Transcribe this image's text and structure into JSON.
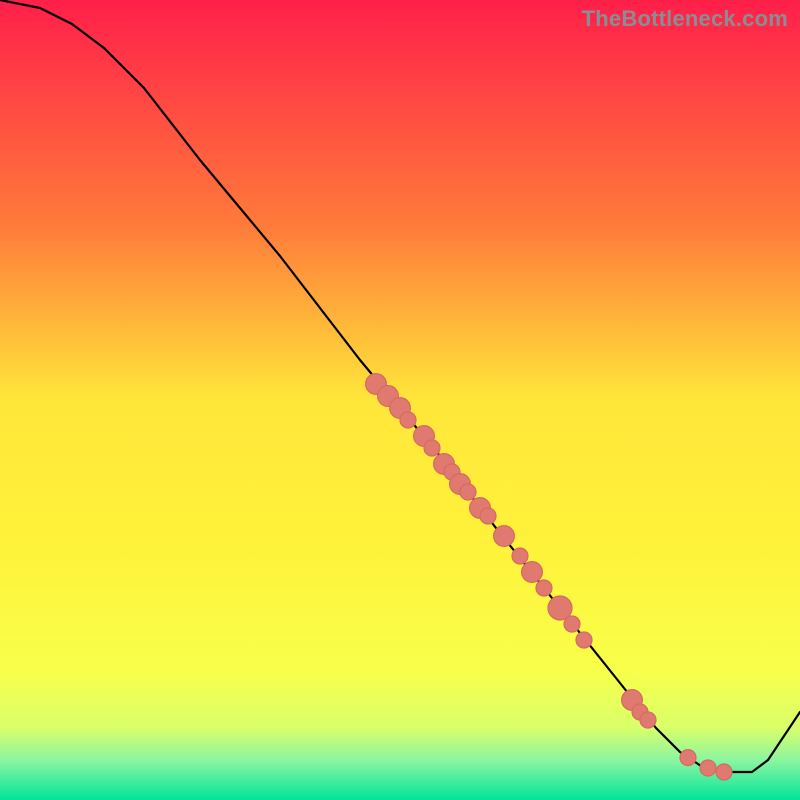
{
  "attribution": "TheBottleneck.com",
  "chart_data": {
    "type": "line",
    "title": "",
    "xlabel": "",
    "ylabel": "",
    "xlim": [
      0,
      100
    ],
    "ylim": [
      0,
      100
    ],
    "grid": false,
    "legend": false,
    "background_gradient": {
      "top": "#ff1f4a",
      "middle_upper": "#ffa33a",
      "middle": "#ffe63a",
      "lower_mid": "#f7ff3a",
      "near_bottom_1": "#bcff6a",
      "near_bottom_2": "#6af0b8",
      "bottom": "#00e59a"
    },
    "line_color": "#000000",
    "line": [
      {
        "x": 0,
        "y": 100
      },
      {
        "x": 5,
        "y": 99
      },
      {
        "x": 9,
        "y": 97
      },
      {
        "x": 13,
        "y": 94
      },
      {
        "x": 18,
        "y": 89
      },
      {
        "x": 25,
        "y": 80
      },
      {
        "x": 35,
        "y": 68
      },
      {
        "x": 45,
        "y": 55
      },
      {
        "x": 55,
        "y": 43
      },
      {
        "x": 62,
        "y": 34
      },
      {
        "x": 70,
        "y": 24
      },
      {
        "x": 78,
        "y": 14
      },
      {
        "x": 82,
        "y": 9
      },
      {
        "x": 85,
        "y": 6
      },
      {
        "x": 88,
        "y": 4
      },
      {
        "x": 90,
        "y": 3.5
      },
      {
        "x": 92,
        "y": 3.5
      },
      {
        "x": 94,
        "y": 3.5
      },
      {
        "x": 96,
        "y": 5
      },
      {
        "x": 98,
        "y": 8
      },
      {
        "x": 100,
        "y": 11
      }
    ],
    "markers": [
      {
        "x": 47,
        "y": 52,
        "r": 1.3
      },
      {
        "x": 48.5,
        "y": 50.5,
        "r": 1.3
      },
      {
        "x": 50,
        "y": 49,
        "r": 1.3
      },
      {
        "x": 51,
        "y": 47.5,
        "r": 1.0
      },
      {
        "x": 53,
        "y": 45.5,
        "r": 1.3
      },
      {
        "x": 54,
        "y": 44,
        "r": 1.0
      },
      {
        "x": 55.5,
        "y": 42,
        "r": 1.3
      },
      {
        "x": 56.5,
        "y": 41,
        "r": 1.0
      },
      {
        "x": 57.5,
        "y": 39.5,
        "r": 1.3
      },
      {
        "x": 58.5,
        "y": 38.5,
        "r": 1.0
      },
      {
        "x": 60,
        "y": 36.5,
        "r": 1.3
      },
      {
        "x": 61,
        "y": 35.5,
        "r": 1.0
      },
      {
        "x": 63,
        "y": 33,
        "r": 1.3
      },
      {
        "x": 65,
        "y": 30.5,
        "r": 1.0
      },
      {
        "x": 66.5,
        "y": 28.5,
        "r": 1.3
      },
      {
        "x": 68,
        "y": 26.5,
        "r": 1.0
      },
      {
        "x": 70,
        "y": 24,
        "r": 1.5
      },
      {
        "x": 71.5,
        "y": 22,
        "r": 1.0
      },
      {
        "x": 73,
        "y": 20,
        "r": 1.0
      },
      {
        "x": 79,
        "y": 12.5,
        "r": 1.3
      },
      {
        "x": 80,
        "y": 11,
        "r": 1.0
      },
      {
        "x": 81,
        "y": 10,
        "r": 1.0
      },
      {
        "x": 86,
        "y": 5.3,
        "r": 1.0
      },
      {
        "x": 88.5,
        "y": 4,
        "r": 1.0
      },
      {
        "x": 90.5,
        "y": 3.5,
        "r": 1.0
      }
    ],
    "marker_color": "#e07a70",
    "marker_stroke": "#d56a60"
  }
}
